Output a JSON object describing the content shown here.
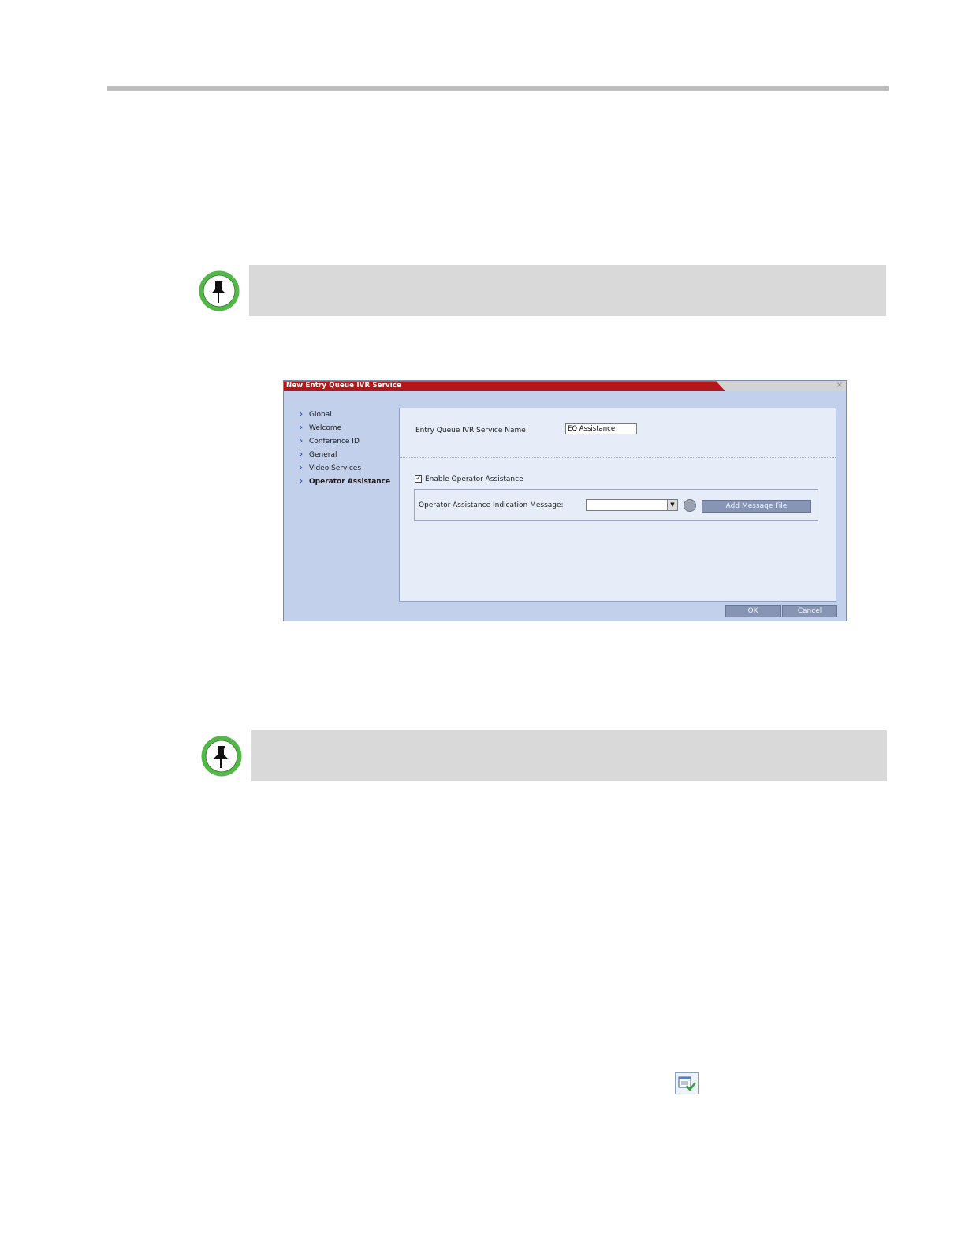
{
  "dialog": {
    "title": "New Entry Queue IVR Service",
    "close_glyph": "×",
    "nav": [
      {
        "label": "Global"
      },
      {
        "label": "Welcome"
      },
      {
        "label": "Conference ID"
      },
      {
        "label": "General"
      },
      {
        "label": "Video Services"
      },
      {
        "label": "Operator Assistance",
        "active": true
      }
    ],
    "service_name_label": "Entry Queue IVR Service Name:",
    "service_name_value": "EQ Assistance",
    "enable_operator_label": "Enable Operator Assistance",
    "enable_operator_checked": true,
    "indication_message_label": "Operator Assistance Indication Message:",
    "indication_message_value": "",
    "add_message_button": "Add Message File",
    "ok_button": "OK",
    "cancel_button": "Cancel"
  },
  "icons": {
    "note_pin": "pushpin-note-icon",
    "play": "play-message-icon",
    "toolbar": "calendar-check-icon"
  },
  "colors": {
    "title_bar": "#b3161b",
    "dialog_bg": "#c3d0ec",
    "panel_bg": "#e7edf8",
    "note_bg": "#d9d9d9",
    "note_icon_green": "#52b848"
  }
}
